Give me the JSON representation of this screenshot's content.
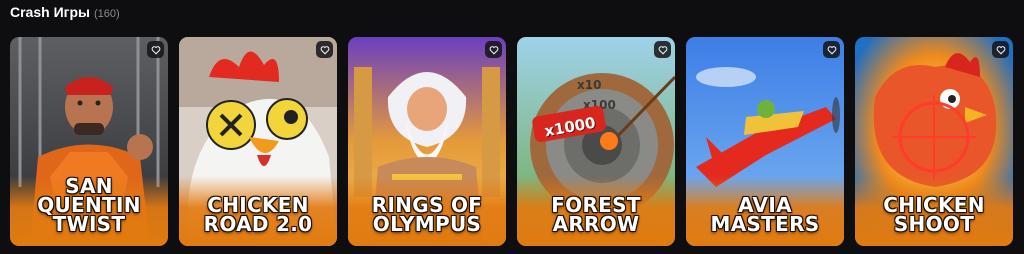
{
  "header": {
    "title": "Crash Игры",
    "count": "(160)"
  },
  "games": [
    {
      "name": "San Quentin Twist",
      "line1": "SAN",
      "line2": "QUENTIN",
      "line3": "TWIST",
      "icon": "heart-icon"
    },
    {
      "name": "Chicken Road 2.0",
      "line1": "CHICKEN",
      "line2": "ROAD 2.0",
      "icon": "heart-icon"
    },
    {
      "name": "Rings of Olympus",
      "line1": "RINGS OF",
      "line2": "OLYMPUS",
      "icon": "heart-icon"
    },
    {
      "name": "Forest Arrow",
      "line1": "FOREST",
      "line2": "ARROW",
      "badge": "x1000",
      "marks": [
        "x10",
        "x100"
      ],
      "icon": "heart-icon"
    },
    {
      "name": "Avia Masters",
      "line1": "AVIA",
      "line2": "MASTERS",
      "icon": "heart-icon"
    },
    {
      "name": "Chicken Shoot",
      "line1": "CHICKEN",
      "line2": "SHOOT",
      "icon": "heart-icon"
    }
  ],
  "colors": {
    "background": "#0e0e10",
    "label_band": "#e07b10",
    "count": "#8a8a92"
  }
}
